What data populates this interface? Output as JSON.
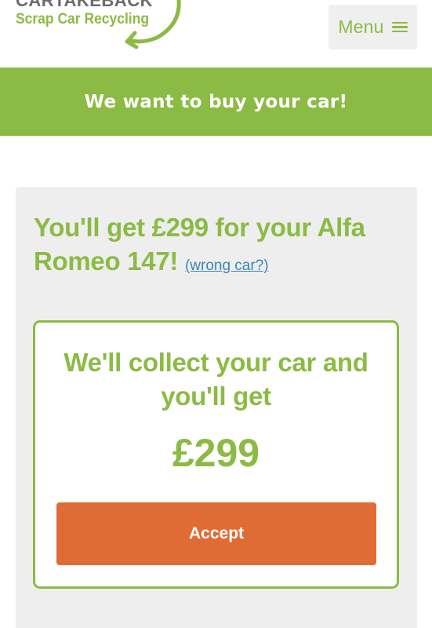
{
  "header": {
    "logo_name": "CARTAKEBACK",
    "logo_tagline": "Scrap Car Recycling",
    "menu_label": "Menu"
  },
  "banner": {
    "text": "We want to buy your car!"
  },
  "quote": {
    "heading": "You'll get £299 for your Alfa Romeo 147!",
    "wrong_car_link": "(wrong car?)"
  },
  "offer": {
    "heading": "We'll collect your car and you'll get",
    "price": "£299",
    "accept_label": "Accept"
  },
  "colors": {
    "brand_green": "#8bbb44",
    "accept_orange": "#e06c35",
    "link_blue": "#3a86b5",
    "panel_grey": "#eeeeee"
  },
  "icons": {
    "menu": "hamburger-icon",
    "logo": "recycling-arrow-icon"
  }
}
